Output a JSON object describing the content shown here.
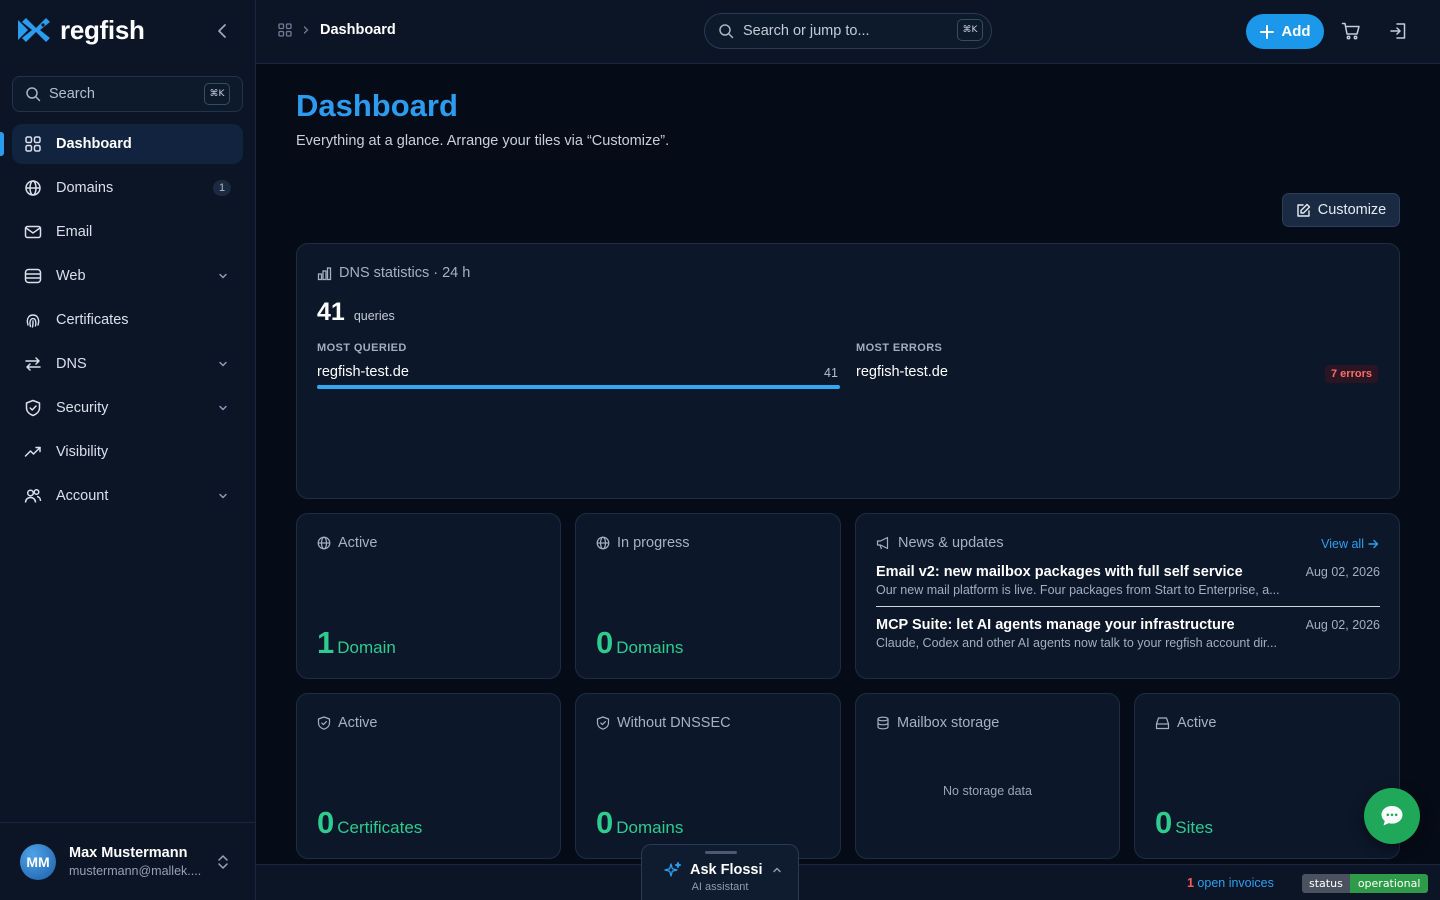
{
  "brand": {
    "name": "regfish",
    "accent": "#2c9cf0",
    "success": "#2ecc8f"
  },
  "sidebar": {
    "search": {
      "label": "Search",
      "shortcut": "⌘K"
    },
    "items": [
      {
        "label": "Dashboard",
        "icon": "grid-icon",
        "active": true
      },
      {
        "label": "Domains",
        "icon": "globe-icon",
        "badge": "1"
      },
      {
        "label": "Email",
        "icon": "mail-icon"
      },
      {
        "label": "Web",
        "icon": "server-icon",
        "expandable": true
      },
      {
        "label": "Certificates",
        "icon": "fingerprint-icon"
      },
      {
        "label": "DNS",
        "icon": "arrows-swap-icon",
        "expandable": true
      },
      {
        "label": "Security",
        "icon": "shield-check-icon",
        "expandable": true
      },
      {
        "label": "Visibility",
        "icon": "trend-up-icon"
      },
      {
        "label": "Account",
        "icon": "users-icon",
        "expandable": true
      }
    ],
    "user": {
      "initials": "MM",
      "name": "Max Mustermann",
      "email": "mustermann@mallek...."
    }
  },
  "topbar": {
    "breadcrumb": "Dashboard",
    "search": {
      "placeholder": "Search or jump to...",
      "shortcut": "⌘K"
    },
    "add_label": "Add"
  },
  "main": {
    "title": "Dashboard",
    "subtitle": "Everything at a glance. Arrange your tiles via “Customize”.",
    "customize_label": "Customize"
  },
  "dns": {
    "title": "DNS statistics · 24 h",
    "queries": "41",
    "queries_unit": "queries",
    "most_queried_label": "MOST QUERIED",
    "most_queried_domain": "regfish-test.de",
    "most_queried_count": "41",
    "most_queried_share": 1.0,
    "most_errors_label": "MOST ERRORS",
    "most_errors_domain": "regfish-test.de",
    "most_errors_badge": "7 errors"
  },
  "tiles": {
    "domains_active": {
      "title": "Active",
      "value": "1",
      "unit": "Domain"
    },
    "domains_progress": {
      "title": "In progress",
      "value": "0",
      "unit": "Domains"
    },
    "certs_active": {
      "title": "Active",
      "value": "0",
      "unit": "Certificates"
    },
    "without_dnssec": {
      "title": "Without DNSSEC",
      "value": "0",
      "unit": "Domains"
    },
    "mailbox": {
      "title": "Mailbox storage",
      "empty": "No storage data"
    },
    "sites_active": {
      "title": "Active",
      "value": "0",
      "unit": "Sites"
    }
  },
  "news": {
    "title": "News & updates",
    "view_all": "View all",
    "items": [
      {
        "title": "Email v2: new mailbox packages with full self service",
        "desc": "Our new mail platform is live. Four packages from Start to Enterprise, a...",
        "date": "Aug 02, 2026"
      },
      {
        "title": "MCP Suite: let AI agents manage your infrastructure",
        "desc": "Claude, Codex and other AI agents now talk to your regfish account dir...",
        "date": "Aug 02, 2026"
      }
    ]
  },
  "footer": {
    "invoice_count": "1",
    "invoice_label": " open invoices",
    "status_key": "status",
    "status_value": "operational"
  },
  "assistant": {
    "title": "Ask Flossi",
    "subtitle": "AI assistant"
  }
}
